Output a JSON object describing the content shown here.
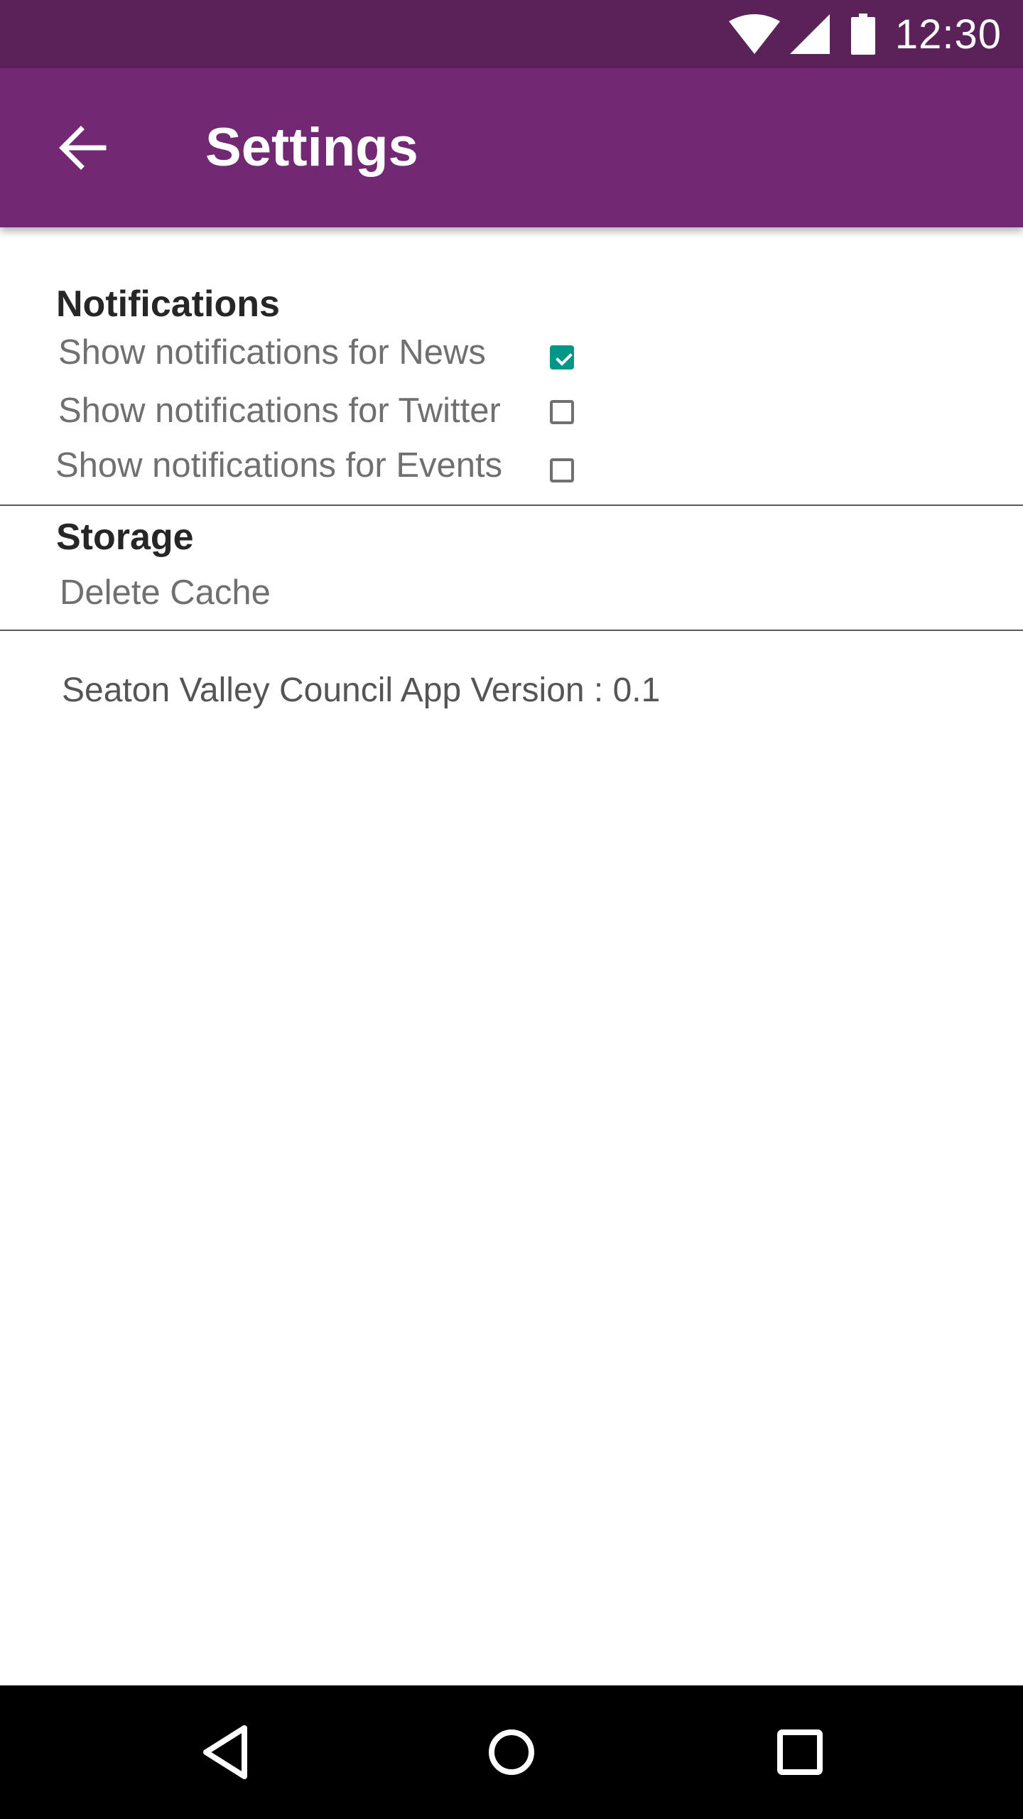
{
  "status_bar": {
    "time": "12:30",
    "icons": [
      "wifi-icon",
      "cell-signal-icon",
      "battery-icon"
    ]
  },
  "app_bar": {
    "title": "Settings",
    "back_icon": "arrow-back-icon"
  },
  "notifications": {
    "header": "Notifications",
    "items": [
      {
        "label": "Show notifications for News",
        "checked": true
      },
      {
        "label": "Show notifications for Twitter",
        "checked": false
      },
      {
        "label": "Show notifications for Events",
        "checked": false
      }
    ]
  },
  "storage": {
    "header": "Storage",
    "delete_cache_label": "Delete Cache"
  },
  "version_text": "Seaton Valley Council App Version : 0.1",
  "nav_bar": {
    "icons": [
      "back-triangle-icon",
      "home-circle-icon",
      "recents-square-icon"
    ]
  },
  "colors": {
    "status_bar": "#5b2159",
    "app_bar": "#722872",
    "checkbox_checked": "#009688"
  }
}
